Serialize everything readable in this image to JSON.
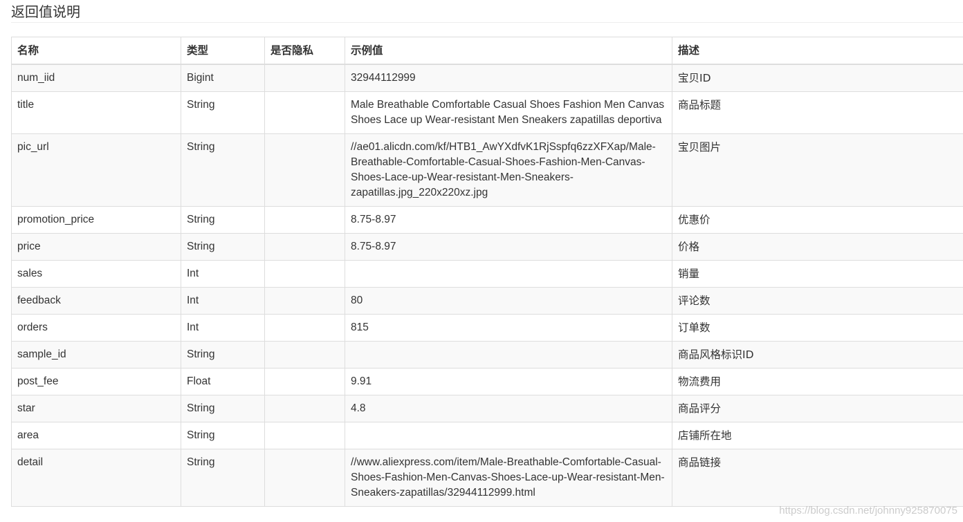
{
  "section_title": "返回值说明",
  "columns": {
    "name": "名称",
    "type": "类型",
    "private": "是否隐私",
    "example": "示例值",
    "desc": "描述"
  },
  "rows": [
    {
      "name": "num_iid",
      "type": "Bigint",
      "private": "",
      "example": "32944112999",
      "desc": "宝贝ID"
    },
    {
      "name": "title",
      "type": "String",
      "private": "",
      "example": "Male Breathable Comfortable Casual Shoes Fashion Men Canvas Shoes Lace up Wear-resistant Men Sneakers zapatillas deportiva",
      "desc": "商品标题"
    },
    {
      "name": "pic_url",
      "type": "String",
      "private": "",
      "example": "//ae01.alicdn.com/kf/HTB1_AwYXdfvK1RjSspfq6zzXFXap/Male-Breathable-Comfortable-Casual-Shoes-Fashion-Men-Canvas-Shoes-Lace-up-Wear-resistant-Men-Sneakers-zapatillas.jpg_220x220xz.jpg",
      "desc": "宝贝图片"
    },
    {
      "name": "promotion_price",
      "type": "String",
      "private": "",
      "example": "8.75-8.97",
      "desc": "优惠价"
    },
    {
      "name": "price",
      "type": "String",
      "private": "",
      "example": "8.75-8.97",
      "desc": "价格"
    },
    {
      "name": "sales",
      "type": "Int",
      "private": "",
      "example": "",
      "desc": "销量"
    },
    {
      "name": "feedback",
      "type": "Int",
      "private": "",
      "example": "80",
      "desc": "评论数"
    },
    {
      "name": "orders",
      "type": "Int",
      "private": "",
      "example": "815",
      "desc": "订单数"
    },
    {
      "name": "sample_id",
      "type": "String",
      "private": "",
      "example": "",
      "desc": "商品风格标识ID"
    },
    {
      "name": "post_fee",
      "type": "Float",
      "private": "",
      "example": "9.91",
      "desc": "物流费用"
    },
    {
      "name": "star",
      "type": "String",
      "private": "",
      "example": "4.8",
      "desc": "商品评分"
    },
    {
      "name": "area",
      "type": "String",
      "private": "",
      "example": "",
      "desc": "店铺所在地"
    },
    {
      "name": "detail",
      "type": "String",
      "private": "",
      "example": "//www.aliexpress.com/item/Male-Breathable-Comfortable-Casual-Shoes-Fashion-Men-Canvas-Shoes-Lace-up-Wear-resistant-Men-Sneakers-zapatillas/32944112999.html",
      "desc": "商品链接"
    }
  ],
  "watermark": "https://blog.csdn.net/johnny925870075"
}
